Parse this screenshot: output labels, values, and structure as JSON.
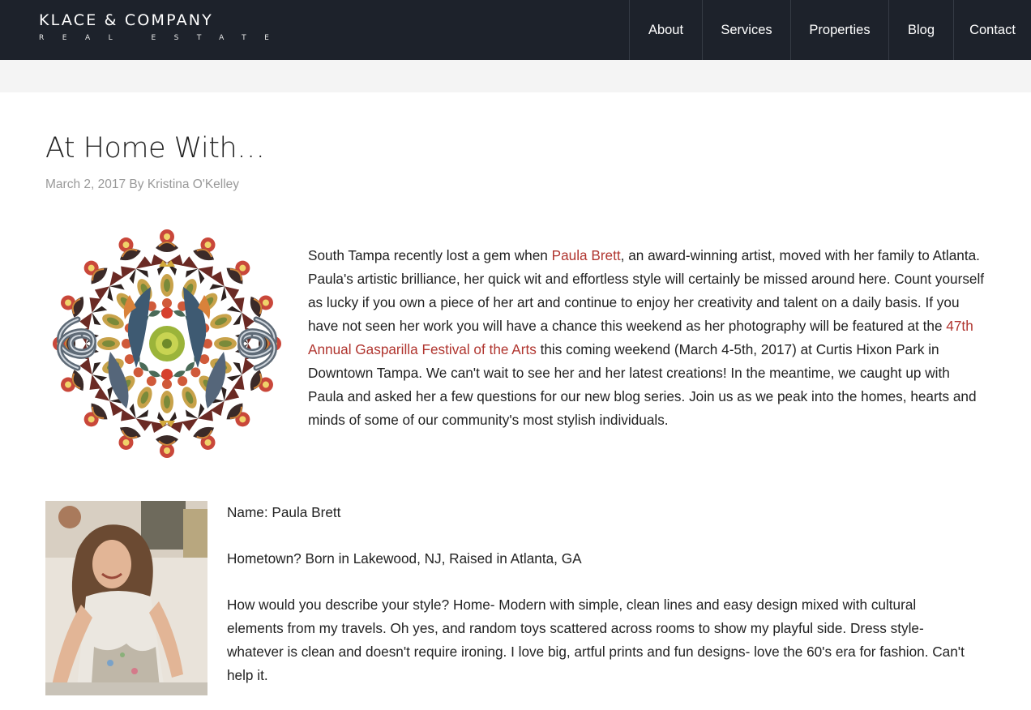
{
  "brand": {
    "name": "KLACE & COMPANY",
    "tagline": "REAL ESTATE"
  },
  "nav": {
    "items": [
      {
        "label": "About"
      },
      {
        "label": "Services"
      },
      {
        "label": "Properties"
      },
      {
        "label": "Blog"
      },
      {
        "label": "Contact"
      }
    ]
  },
  "post": {
    "title": "At Home With…",
    "date": "March 2, 2017",
    "by": "By",
    "author": "Kristina O'Kelley",
    "intro": {
      "t1": "South Tampa recently lost a gem when ",
      "link1": "Paula Brett",
      "t2": ", an award-winning artist, moved with her family to Atlanta. Paula's artistic brilliance, her quick wit and effortless style will certainly be missed around here. Count yourself as lucky if you own a piece of her art and continue to enjoy her creativity and talent on a daily basis. If you have not seen her work you will have a chance this weekend as her photography will be featured at the ",
      "link2": "47th Annual Gasparilla Festival of the Arts",
      "t3": " this coming weekend (March 4-5th, 2017) at Curtis Hixon Park in Downtown Tampa. We can't wait to see her and her latest creations! In the meantime, we caught up with Paula and asked her a few questions for our new blog series. Join us as we peak into the homes, hearts and minds of some of our community's most stylish individuals."
    },
    "qa": {
      "name": "Name: Paula Brett",
      "hometown": "Hometown? Born in Lakewood, NJ, Raised in Atlanta, GA",
      "style": "How would you describe your style? Home- Modern with simple, clean lines and easy design mixed with cultural elements from my travels. Oh yes, and random toys scattered across rooms to show my playful side. Dress style- whatever is clean and doesn't require ironing. I love big, artful prints and fun designs- love the 60's era for fashion. Can't help it."
    }
  },
  "colors": {
    "header_bg": "#1d222b",
    "link": "#b0352f",
    "band": "#f4f4f4",
    "meta_text": "#999999"
  }
}
